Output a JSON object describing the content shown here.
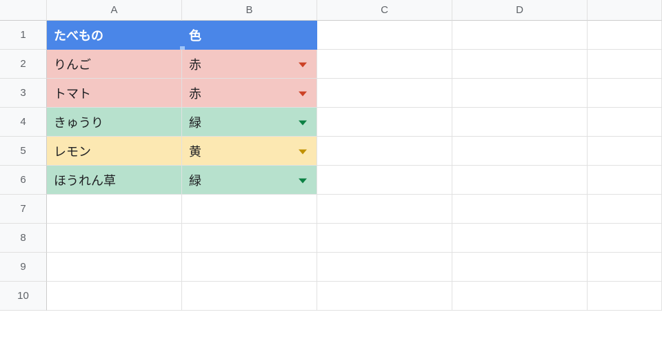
{
  "columns": [
    "A",
    "B",
    "C",
    "D",
    ""
  ],
  "row_numbers": [
    "1",
    "2",
    "3",
    "4",
    "5",
    "6",
    "7",
    "8",
    "9",
    "10"
  ],
  "header": {
    "A": "たべもの",
    "B": "色"
  },
  "rows": [
    {
      "food": "りんご",
      "color": "赤",
      "fill": "red",
      "arrow": "red"
    },
    {
      "food": "トマト",
      "color": "赤",
      "fill": "red",
      "arrow": "red"
    },
    {
      "food": "きゅうり",
      "color": "緑",
      "fill": "green",
      "arrow": "green"
    },
    {
      "food": "レモン",
      "color": "黄",
      "fill": "yellow",
      "arrow": "yellow"
    },
    {
      "food": "ほうれん草",
      "color": "緑",
      "fill": "green",
      "arrow": "green"
    }
  ],
  "chart_data": {
    "type": "table",
    "columns": [
      "たべもの",
      "色"
    ],
    "data": [
      [
        "りんご",
        "赤"
      ],
      [
        "トマト",
        "赤"
      ],
      [
        "きゅうり",
        "緑"
      ],
      [
        "レモン",
        "黄"
      ],
      [
        "ほうれん草",
        "緑"
      ]
    ]
  },
  "colors": {
    "header_bg": "#4a86e8",
    "red_bg": "#f4c7c3",
    "green_bg": "#b7e1cd",
    "yellow_bg": "#fce8b2"
  }
}
